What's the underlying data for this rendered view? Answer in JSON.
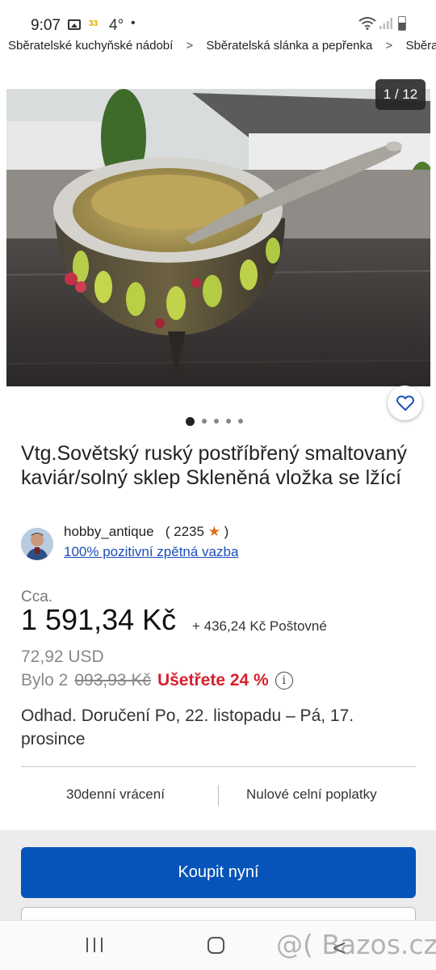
{
  "status_bar": {
    "time": "9:07",
    "badge": "33",
    "temp": "4°",
    "dot": "•"
  },
  "breadcrumb": [
    "Sběratelské kuchyňské nádobí",
    "Sběratelská slánka a pepřenka",
    "Sběrate"
  ],
  "gallery": {
    "counter": "1 / 12",
    "total_dots": 5,
    "active_dot": 0
  },
  "item": {
    "title": "Vtg.Sovětský ruský postříbřený smaltovaný kaviár/solný sklep Skleněná vložka se lžící"
  },
  "seller": {
    "name": "hobby_antique",
    "rating_open": "(",
    "rating_count": "2235",
    "rating_close": ")",
    "feedback": "100% pozitivní zpětná vazba"
  },
  "price": {
    "approx_label": "Cca.",
    "amount": "1 591,34 Kč",
    "shipping": "+ 436,24 Kč Poštovné",
    "usd": "72,92 USD",
    "was_label": "Bylo 2",
    "was_value": "093,93 Kč",
    "savings": "Ušetřete 24 %"
  },
  "delivery": "Odhad. Doručení Po, 22. listopadu – Pá, 17. prosince",
  "features": [
    "30denní vrácení",
    "Nulové celní poplatky"
  ],
  "buttons": {
    "buy_now": "Koupit nyní"
  },
  "watermark": "@( Bazos.cz",
  "colors": {
    "primary": "#0654ba",
    "savings": "#d6202d",
    "star": "#e26a1b",
    "link": "#1a4fb8"
  }
}
